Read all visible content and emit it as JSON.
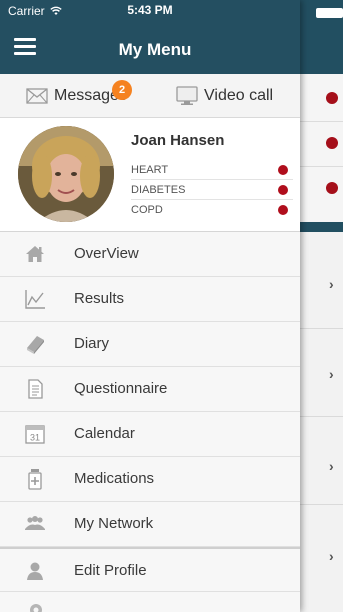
{
  "status_bar": {
    "carrier": "Carrier",
    "time": "5:43 PM"
  },
  "header": {
    "title": "My Menu"
  },
  "actions": {
    "messages_label": "Messages",
    "messages_badge": "2",
    "video_call_label": "Video call"
  },
  "profile": {
    "name": "Joan Hansen",
    "conditions": [
      {
        "label": "HEART",
        "status_color": "#b00e1c"
      },
      {
        "label": "DIABETES",
        "status_color": "#b00e1c"
      },
      {
        "label": "COPD",
        "status_color": "#b00e1c"
      }
    ]
  },
  "menu": {
    "items": [
      {
        "label": "OverView",
        "icon": "home-icon"
      },
      {
        "label": "Results",
        "icon": "chart-icon"
      },
      {
        "label": "Diary",
        "icon": "book-icon"
      },
      {
        "label": "Questionnaire",
        "icon": "document-icon"
      },
      {
        "label": "Calendar",
        "icon": "calendar-icon",
        "icon_text": "31"
      },
      {
        "label": "Medications",
        "icon": "medication-icon"
      },
      {
        "label": "My Network",
        "icon": "people-icon"
      },
      {
        "label": "Edit Profile",
        "icon": "person-icon"
      }
    ]
  },
  "theme": {
    "header_bg": "#244f61",
    "badge_color": "#f58220",
    "status_red": "#b00e1c"
  }
}
